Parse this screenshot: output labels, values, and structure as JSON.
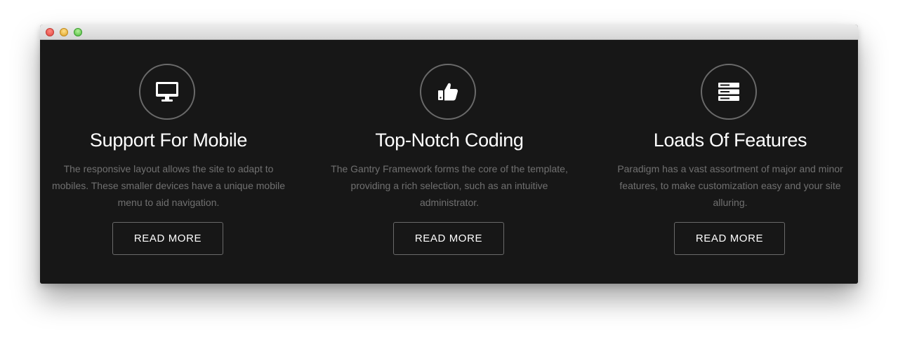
{
  "features": [
    {
      "icon": "desktop-icon",
      "title": "Support For Mobile",
      "description": "The responsive layout allows the site to adapt to mobiles. These smaller devices have a unique mobile menu to aid navigation.",
      "button_label": "READ MORE"
    },
    {
      "icon": "thumbs-up-icon",
      "title": "Top-Notch Coding",
      "description": "The Gantry Framework forms the core of the template, providing a rich selection, such as an intuitive administrator.",
      "button_label": "READ MORE"
    },
    {
      "icon": "server-icon",
      "title": "Loads Of Features",
      "description": "Paradigm has a vast assortment of major and minor features, to make customization easy and your site alluring.",
      "button_label": "READ MORE"
    }
  ],
  "colors": {
    "background": "#171717",
    "title_text": "#ffffff",
    "description_text": "#707070",
    "circle_border": "#6a6a6a"
  }
}
